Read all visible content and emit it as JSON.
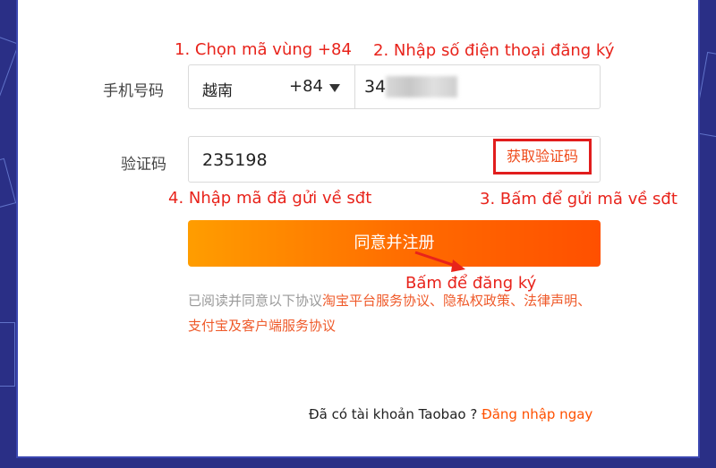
{
  "annotations": {
    "step1": "1. Chọn mã vùng +84",
    "step2": "2. Nhập số điện thoại đăng ký",
    "step3": "3. Bấm để gửi mã về sđt",
    "step4": "4. Nhập mã đã gửi về sđt",
    "submit_hint": "Bấm để đăng ký"
  },
  "form": {
    "phone_label": "手机号码",
    "country_name": "越南",
    "country_code": "+84",
    "phone_value": "34",
    "code_label": "验证码",
    "code_value": "235198",
    "get_code_label": "获取验证码",
    "submit_label": "同意并注册"
  },
  "terms": {
    "prefix": "已阅读并同意以下协议",
    "link1": "淘宝平台服务协议",
    "sep1": "、",
    "link2": "隐私权政策",
    "sep2": "、",
    "link3": "法律声明",
    "sep3": "、",
    "link4": "支付宝及客户端服务协议"
  },
  "footer": {
    "question": "Đã có tài khoản Taobao ?",
    "login_link": "Đăng nhập ngay"
  },
  "colors": {
    "annotation": "#e8231b",
    "accent": "#ff5000",
    "background": "#2a2f86"
  }
}
